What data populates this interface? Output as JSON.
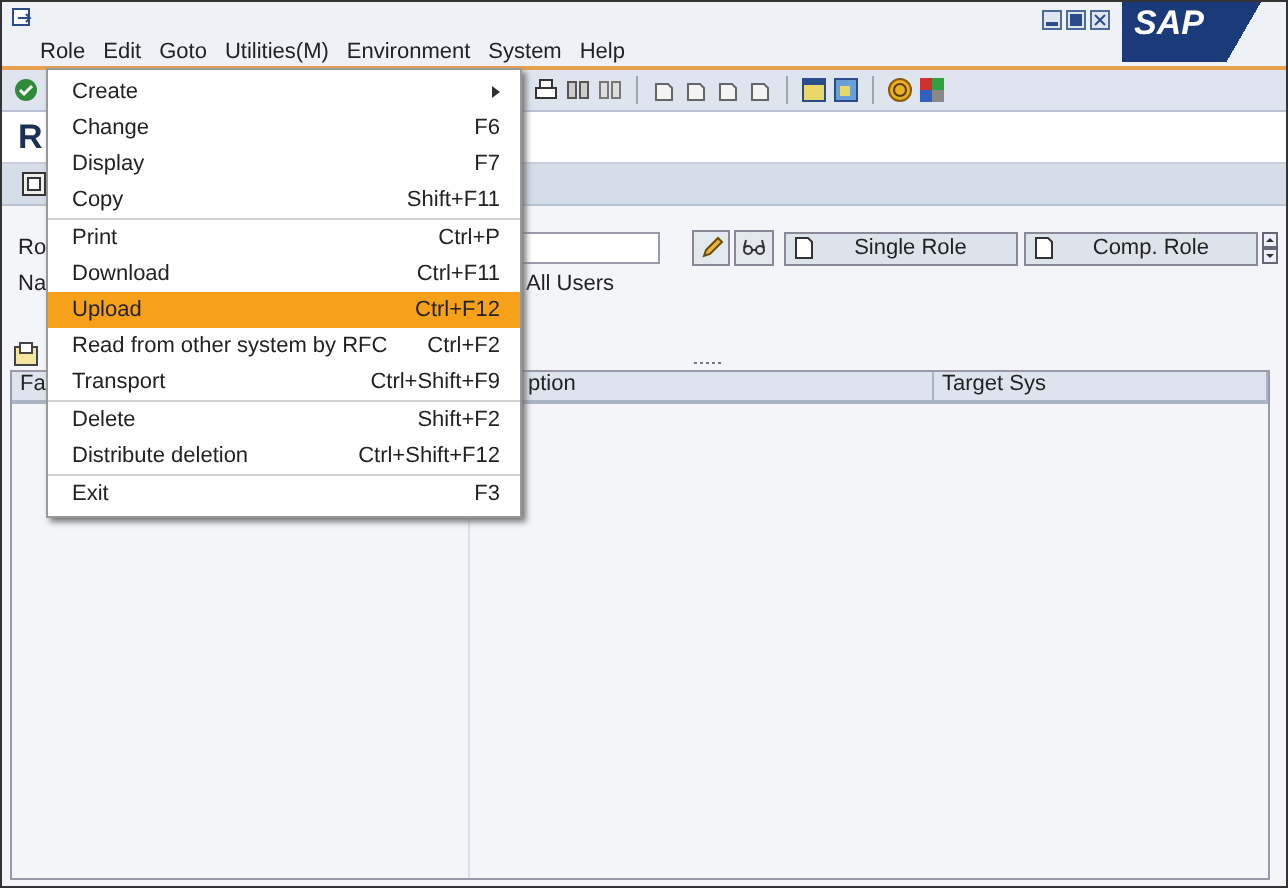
{
  "menubar": [
    {
      "label": "Role"
    },
    {
      "label": "Edit"
    },
    {
      "label": "Goto"
    },
    {
      "label": "Utilities(M)"
    },
    {
      "label": "Environment"
    },
    {
      "label": "System"
    },
    {
      "label": "Help"
    }
  ],
  "logo": "SAP",
  "screen_title": "R",
  "fields": [
    {
      "label": "Ro"
    },
    {
      "label": "Na"
    }
  ],
  "option_label": "All Users",
  "buttons": [
    "Single Role",
    "Comp. Role"
  ],
  "table": {
    "columns": [
      "Fa",
      "ption",
      "Target Sys"
    ]
  },
  "menu": {
    "groups": [
      [
        {
          "label": "Create",
          "submenu": true,
          "selected": false
        },
        {
          "label": "Change",
          "shortcut": "F6",
          "submenu": false,
          "selected": false
        },
        {
          "label": "Display",
          "shortcut": "F7",
          "submenu": false,
          "selected": false
        },
        {
          "label": "Copy",
          "shortcut": "Shift+F11",
          "submenu": false,
          "selected": false
        }
      ],
      [
        {
          "label": "Print",
          "shortcut": "Ctrl+P",
          "submenu": false,
          "selected": false
        },
        {
          "label": "Download",
          "shortcut": "Ctrl+F11",
          "submenu": false,
          "selected": false
        },
        {
          "label": "Upload",
          "shortcut": "Ctrl+F12",
          "submenu": false,
          "selected": true
        },
        {
          "label": "Read from other system by RFC",
          "shortcut": "Ctrl+F2",
          "submenu": false,
          "selected": false
        },
        {
          "label": "Transport",
          "shortcut": "Ctrl+Shift+F9",
          "submenu": false,
          "selected": false
        }
      ],
      [
        {
          "label": "Delete",
          "shortcut": "Shift+F2",
          "submenu": false,
          "selected": false
        },
        {
          "label": "Distribute deletion",
          "shortcut": "Ctrl+Shift+F12",
          "submenu": false,
          "selected": false
        }
      ],
      [
        {
          "label": "Exit",
          "shortcut": "F3",
          "submenu": false,
          "selected": false
        }
      ]
    ]
  }
}
